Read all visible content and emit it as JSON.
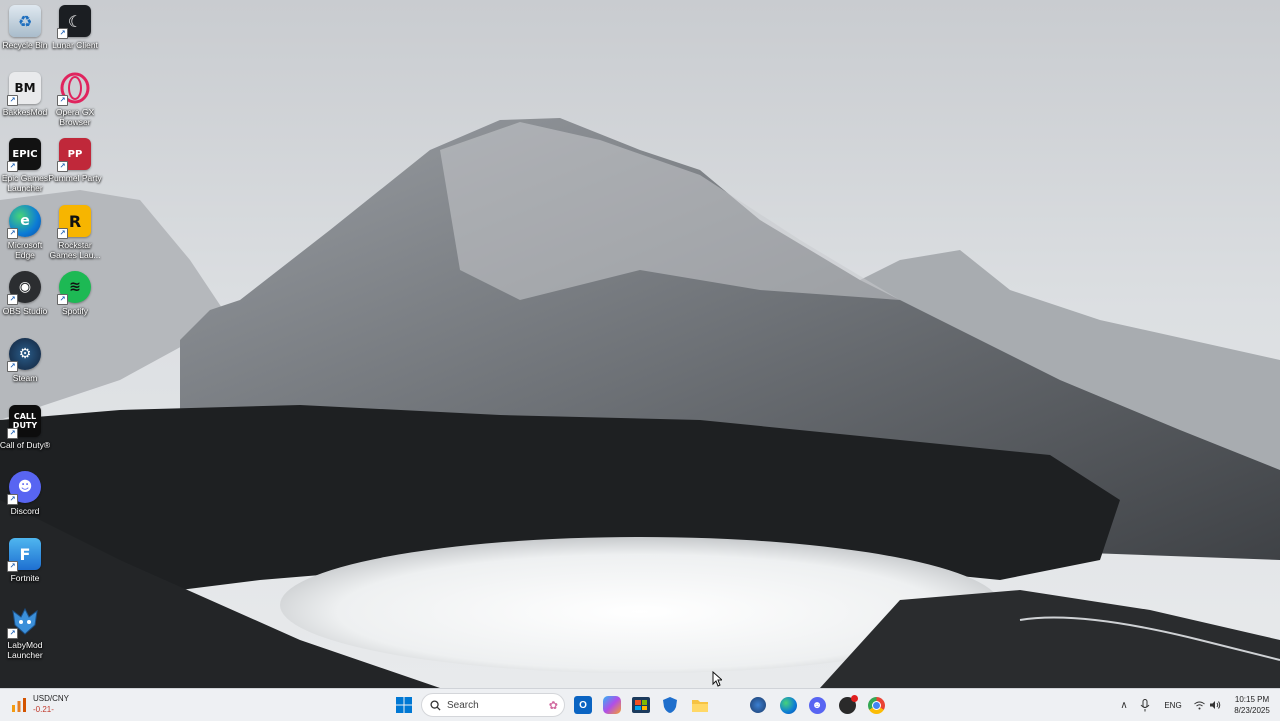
{
  "desktop": {
    "icons": [
      {
        "label": "Recycle Bin"
      },
      {
        "label": "Lunar Client"
      },
      {
        "label": "BakkesMod"
      },
      {
        "label": "Opera GX Browser"
      },
      {
        "label": "Epic Games Launcher"
      },
      {
        "label": "Pummel Party"
      },
      {
        "label": "Microsoft Edge"
      },
      {
        "label": "Rockstar Games Lau..."
      },
      {
        "label": "OBS Studio"
      },
      {
        "label": "Spotify"
      },
      {
        "label": "Steam"
      },
      {
        "label": "Call of Duty®"
      },
      {
        "label": "Discord"
      },
      {
        "label": "Fortnite"
      },
      {
        "label": "LabyMod Launcher"
      }
    ]
  },
  "taskbar": {
    "widget": {
      "title": "USD/CNY",
      "value": "-0.21-"
    },
    "search_placeholder": "Search",
    "tray": {
      "language": "ENG",
      "time": "10:15 PM",
      "date": "8/23/2025"
    }
  },
  "colors": {
    "taskbar_bg": "#eef0f3",
    "accent": "#0078d4"
  }
}
